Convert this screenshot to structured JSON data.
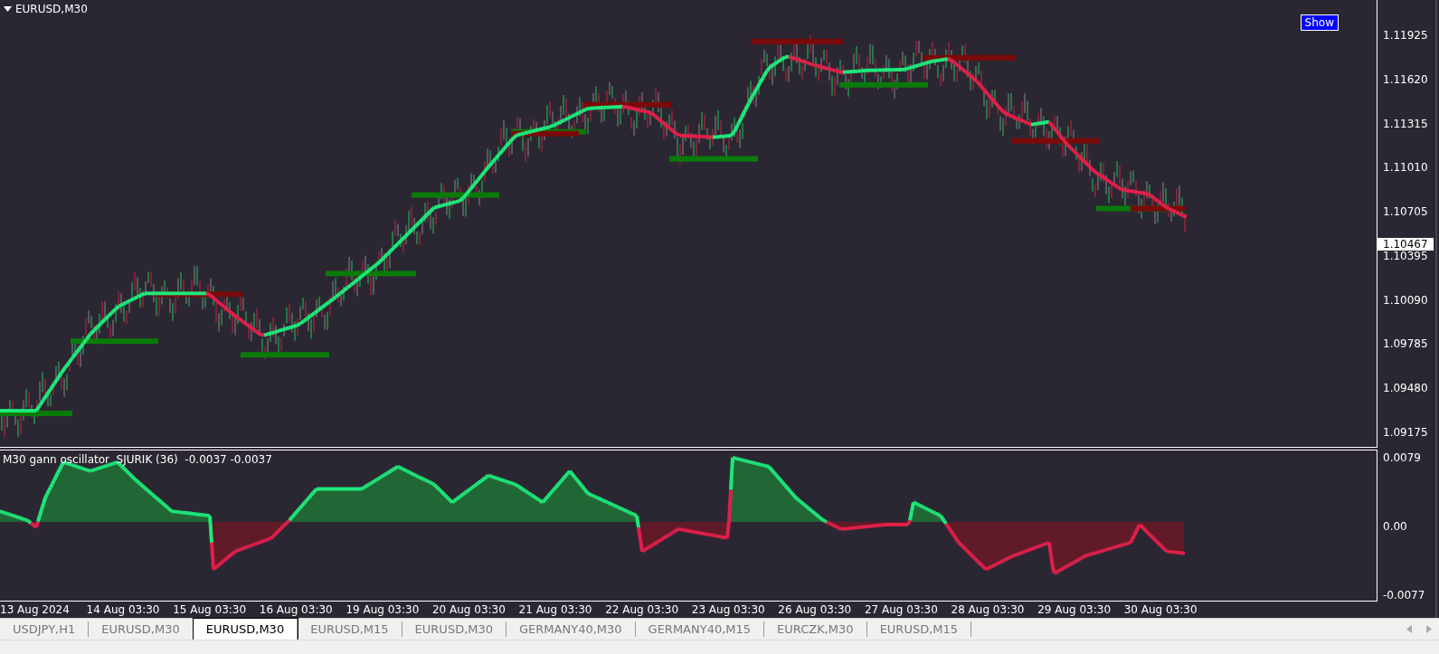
{
  "chart": {
    "symbol": "EURUSD,M30",
    "show_button": "Show",
    "price_ticks": [
      "1.11925",
      "1.11620",
      "1.11315",
      "1.11010",
      "1.10705",
      "1.10395",
      "1.10090",
      "1.09785",
      "1.09480",
      "1.09175"
    ],
    "current_price": "1.10467"
  },
  "oscillator": {
    "label": "M30 gann oscillator  SJURIK (36)  -0.0037 -0.0037",
    "ticks": [
      "0.0079",
      "0.00",
      "-0.0077"
    ]
  },
  "time_axis": [
    "13 Aug 2024",
    "14 Aug 03:30",
    "15 Aug 03:30",
    "16 Aug 03:30",
    "19 Aug 03:30",
    "20 Aug 03:30",
    "21 Aug 03:30",
    "22 Aug 03:30",
    "23 Aug 03:30",
    "26 Aug 03:30",
    "27 Aug 03:30",
    "28 Aug 03:30",
    "29 Aug 03:30",
    "30 Aug 03:30"
  ],
  "tabs": [
    {
      "label": "USDJPY,H1",
      "selected": false
    },
    {
      "label": "EURUSD,M30",
      "selected": false
    },
    {
      "label": "EURUSD,M30",
      "selected": true
    },
    {
      "label": "EURUSD,M15",
      "selected": false
    },
    {
      "label": "EURUSD,M30",
      "selected": false
    },
    {
      "label": "GERMANY40,M30",
      "selected": false
    },
    {
      "label": "GERMANY40,M15",
      "selected": false
    },
    {
      "label": "EURCZK,M30",
      "selected": false
    },
    {
      "label": "EURUSD,M15",
      "selected": false
    }
  ]
}
